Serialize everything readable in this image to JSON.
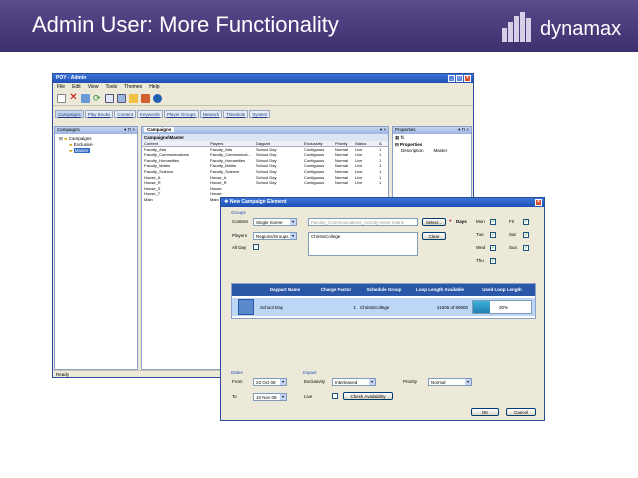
{
  "slide": {
    "title": "Admin User: More Functionality",
    "logo_text": "dynamax"
  },
  "main_window": {
    "title": "POY - Admin",
    "menu": [
      "File",
      "Edit",
      "View",
      "Tools",
      "Themes",
      "Help"
    ],
    "nav_tabs": [
      "Campaigns",
      "Play Books",
      "Content",
      "Keywords",
      "Player Groups",
      "Network",
      "Timeslots",
      "System"
    ],
    "left_panel": {
      "title": "Campaigns",
      "tree": [
        "Campaigns",
        "Exclusive",
        "Master"
      ]
    },
    "center_panel": {
      "tab": "Campaigns",
      "subtitle": "Campaigns\\Master",
      "columns": [
        "Content",
        "Players",
        "Daypart",
        "Exclusivity",
        "Priority",
        "Status",
        "A"
      ],
      "rows": [
        [
          "Faculty_Arts",
          "Faculty_Arts",
          "School Day",
          "Contiguous",
          "Normal",
          "Live",
          "1"
        ],
        [
          "Faculty_Communications",
          "Faculty_Communicat...",
          "School Day",
          "Contiguous",
          "Normal",
          "Live",
          "1"
        ],
        [
          "Faculty_Humanities",
          "Faculty_Humanities",
          "School Day",
          "Contiguous",
          "Normal",
          "Live",
          "1"
        ],
        [
          "Faculty_Maths",
          "Faculty_Maths",
          "School Day",
          "Contiguous",
          "Normal",
          "Live",
          "1"
        ],
        [
          "Faculty_Science",
          "Faculty_Science",
          "School Day",
          "Contiguous",
          "Normal",
          "Live",
          "1"
        ],
        [
          "House_A",
          "House_A",
          "School Day",
          "Contiguous",
          "Normal",
          "Live",
          "1"
        ],
        [
          "House_R",
          "House_R",
          "School Day",
          "Contiguous",
          "Normal",
          "Live",
          "1"
        ],
        [
          "House_S",
          "House",
          "",
          "",
          "",
          "",
          ""
        ],
        [
          "House_T",
          "House",
          "",
          "",
          "",
          "",
          ""
        ],
        [
          "Main",
          "Main",
          "",
          "",
          "",
          "",
          ""
        ]
      ]
    },
    "properties": {
      "title": "Properties",
      "section": "Properties",
      "key": "Description",
      "value": "Master"
    },
    "status": "Ready"
  },
  "dialog": {
    "title": "New Campaign Element",
    "groups_label": "Groups",
    "content_label": "Content",
    "content_select": "Single Scene",
    "content_value": "Faculty_Communications_Activity event matrix",
    "select_button": "Select...",
    "clear_button": "Clear",
    "players_label": "Players",
    "players_select": "Regions/Groups",
    "players_value": "ChristsCollege",
    "allday_label": "All Day",
    "days_label": "Days",
    "days": [
      "Mon",
      "Tue",
      "Wed",
      "Thu",
      "Fri",
      "Sat",
      "Sun"
    ],
    "table": {
      "columns": [
        "Daypart Name",
        "Charge Factor",
        "Schedule Group",
        "Loop Length Available",
        "Used Loop Length"
      ],
      "row": [
        "School Day",
        "1",
        "ChristsCollege",
        "41505 of 60000",
        "30%"
      ]
    },
    "dates_label": "Dates",
    "from_label": "From",
    "from_value": "23 Oct 09",
    "to_label": "To",
    "to_value": "10 Nov 09",
    "impact_label": "Impact",
    "exclusivity_label": "Exclusivity",
    "exclusivity_value": "Interleaved",
    "priority_label": "Priority",
    "priority_value": "Normal",
    "live_label": "Live",
    "check_button": "Check Availability",
    "ok_button": "OK",
    "cancel_button": "Cancel",
    "used_loop_fraction": 0.3
  },
  "colors": {
    "header": "#4a3a7c",
    "titlebar": "#2a5fc8",
    "table_header": "#2b57a8",
    "selected_row": "#bcd6f5"
  }
}
